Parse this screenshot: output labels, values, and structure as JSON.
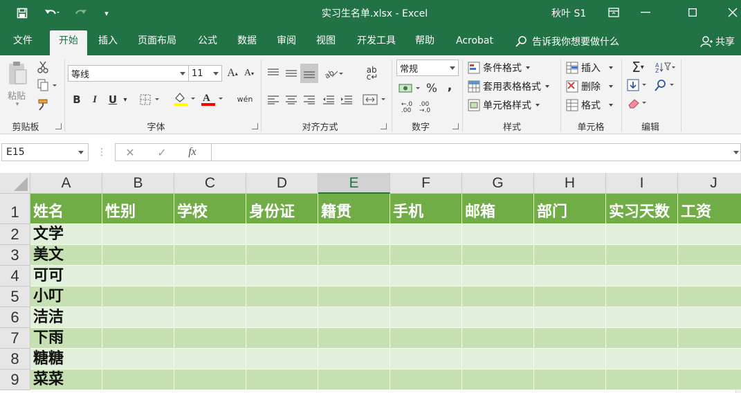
{
  "window": {
    "title": "实习生名单.xlsx  -  Excel",
    "user": "秋叶 S1"
  },
  "colors": {
    "brand": "#217346",
    "table_header": "#70ad47",
    "band_dark": "#c6e0b4",
    "band_light": "#e2efda"
  },
  "tabs": [
    "文件",
    "开始",
    "插入",
    "页面布局",
    "公式",
    "数据",
    "审阅",
    "视图",
    "开发工具",
    "帮助",
    "Acrobat"
  ],
  "tell_me": "告诉我你想要做什么",
  "share": "共享",
  "ribbon": {
    "clipboard": {
      "label": "剪贴板",
      "paste": "粘贴"
    },
    "font": {
      "label": "字体",
      "name": "等线",
      "size": "11",
      "bold": "B",
      "italic": "I",
      "underline": "U"
    },
    "alignment": {
      "label": "对齐方式"
    },
    "number": {
      "label": "数字",
      "format": "常规",
      "percent": "%",
      "comma": ","
    },
    "styles": {
      "label": "样式",
      "conditional": "条件格式",
      "table": "套用表格格式",
      "cell": "单元格样式"
    },
    "cells": {
      "label": "单元格",
      "insert": "插入",
      "delete": "删除",
      "format": "格式"
    },
    "editing": {
      "label": "编辑"
    }
  },
  "formula_bar": {
    "name_box": "E15",
    "cancel": "✕",
    "enter": "✓",
    "fx": "fx",
    "value": ""
  },
  "sheet": {
    "columns": [
      "A",
      "B",
      "C",
      "D",
      "E",
      "F",
      "G",
      "H",
      "I",
      "J"
    ],
    "selected_column": "E",
    "row_numbers": [
      "1",
      "2",
      "3",
      "4",
      "5",
      "6",
      "7",
      "8",
      "9"
    ],
    "header_row": [
      "姓名",
      "性别",
      "学校",
      "身份证",
      "籍贯",
      "手机",
      "邮箱",
      "部门",
      "实习天数",
      "工资"
    ],
    "names": [
      "文学",
      "美文",
      "可可",
      "小叮",
      "洁洁",
      "下雨",
      "糖糖",
      "菜菜"
    ]
  }
}
